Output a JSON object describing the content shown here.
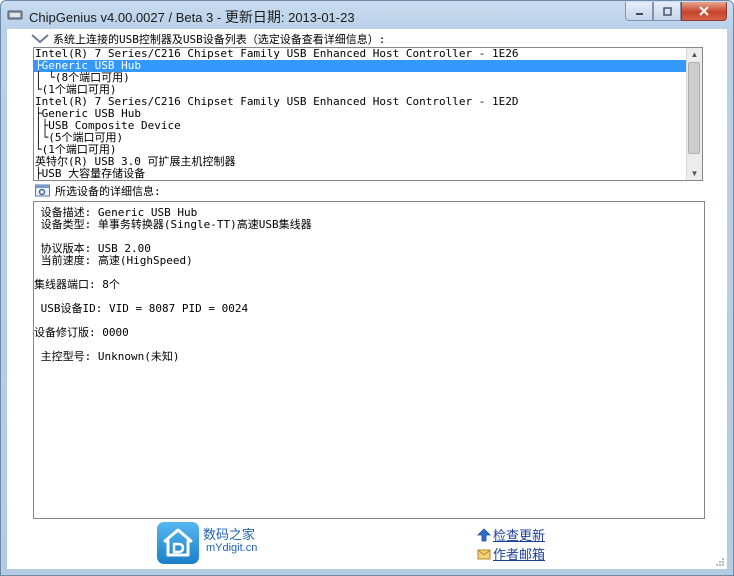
{
  "window": {
    "title_app": "ChipGenius v4.00.0027 / Beta 3 - ",
    "title_label": "更新日期",
    "title_date": ": 2013-01-23"
  },
  "device_section": {
    "label": "系统上连接的USB控制器及USB设备列表（选定设备查看详细信息）:",
    "rows": [
      "Intel(R) 7 Series/C216 Chipset Family USB Enhanced Host Controller - 1E26",
      "├Generic USB Hub",
      "│ └(8个端口可用)",
      "└(1个端口可用)",
      "Intel(R) 7 Series/C216 Chipset Family USB Enhanced Host Controller - 1E2D",
      "├Generic USB Hub",
      "│├USB Composite Device",
      "│└(5个端口可用)",
      "└(1个端口可用)",
      "英特尔(R) USB 3.0 可扩展主机控制器",
      "├USB 大容量存储设备"
    ],
    "selected_index": 1
  },
  "details_section": {
    "label": "所选设备的详细信息:",
    "rows": [
      {
        "label": " 设备描述",
        "value": ": Generic USB Hub"
      },
      {
        "label": " 设备类型",
        "value": ": 单事务转换器(Single-TT)高速USB集线器"
      },
      {
        "label": " 协议版本",
        "value": ": USB 2.00"
      },
      {
        "label": " 当前速度",
        "value": ": 高速(HighSpeed)"
      },
      {
        "label": "集线器端口",
        "value": ": 8个"
      },
      {
        "label": " USB设备ID",
        "value": ": VID = 8087 PID = 0024"
      },
      {
        "label": "设备修订版",
        "value": ": 0000"
      },
      {
        "label": " 主控型号",
        "value": ": Unknown(未知)"
      }
    ]
  },
  "footer": {
    "logo_name": "数码之家",
    "logo_url_text": "mYdigit.cn",
    "check_update": "检查更新",
    "author_email": "作者邮箱"
  }
}
